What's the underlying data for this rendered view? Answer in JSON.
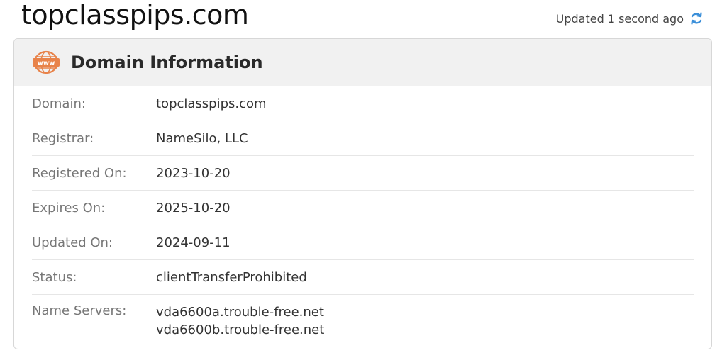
{
  "page": {
    "title": "topclasspips.com",
    "updated_text": "Updated 1 second ago"
  },
  "panel": {
    "title": "Domain Information",
    "icon_text": "www",
    "rows": [
      {
        "label": "Domain:",
        "value": "topclasspips.com"
      },
      {
        "label": "Registrar:",
        "value": "NameSilo, LLC"
      },
      {
        "label": "Registered On:",
        "value": "2023-10-20"
      },
      {
        "label": "Expires On:",
        "value": "2025-10-20"
      },
      {
        "label": "Updated On:",
        "value": "2024-09-11"
      },
      {
        "label": "Status:",
        "value": "clientTransferProhibited"
      },
      {
        "label": "Name Servers:",
        "values": [
          "vda6600a.trouble-free.net",
          "vda6600b.trouble-free.net"
        ]
      }
    ]
  },
  "colors": {
    "accent_orange": "#e8834a",
    "refresh_blue": "#3b8fd9"
  }
}
